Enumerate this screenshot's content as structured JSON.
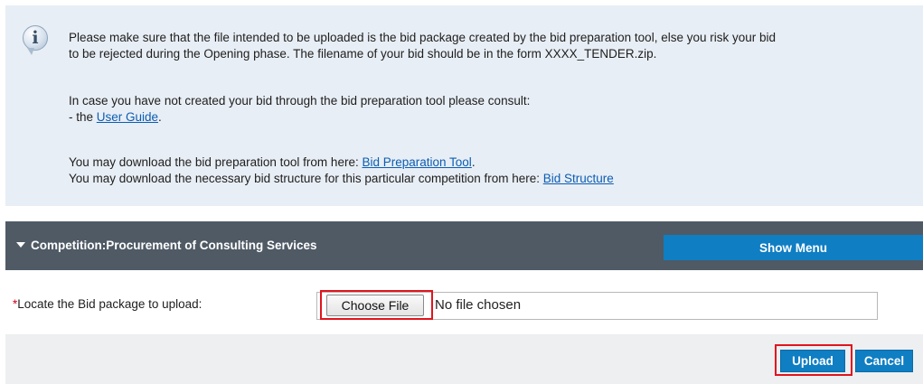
{
  "info": {
    "icon": "info-icon",
    "line1": "Please make sure that the file intended to be uploaded is the bid package created by the bid preparation tool, else you risk your bid",
    "line2": "to be rejected during the Opening phase. The filename of your bid should be in the form XXXX_TENDER.zip.",
    "line3": "In case you have not created your bid through the bid preparation tool please consult:",
    "line4_prefix": "- the ",
    "user_guide_link": "User Guide",
    "line4_suffix": ".",
    "line5_prefix": "You may download the bid preparation tool from here: ",
    "bid_tool_link": "Bid Preparation Tool",
    "line5_suffix": ".",
    "line6_prefix": "You may download the necessary bid structure for this particular competition from here: ",
    "bid_structure_link": "Bid Structure"
  },
  "competition": {
    "title": "Competition:Procurement of Consulting Services",
    "show_menu_label": "Show Menu",
    "caret_icon": "caret-down-icon"
  },
  "upload_form": {
    "required_mark": "*",
    "label": "Locate the Bid package to upload:",
    "choose_file_label": "Choose File",
    "no_file_text": "No file chosen"
  },
  "actions": {
    "upload_label": "Upload",
    "cancel_label": "Cancel"
  },
  "colors": {
    "info_bg": "#e8eef5",
    "bar_bg": "#4f5a65",
    "accent_blue": "#0f7ec3",
    "highlight_red": "#e0151d",
    "link": "#0b5db3"
  }
}
